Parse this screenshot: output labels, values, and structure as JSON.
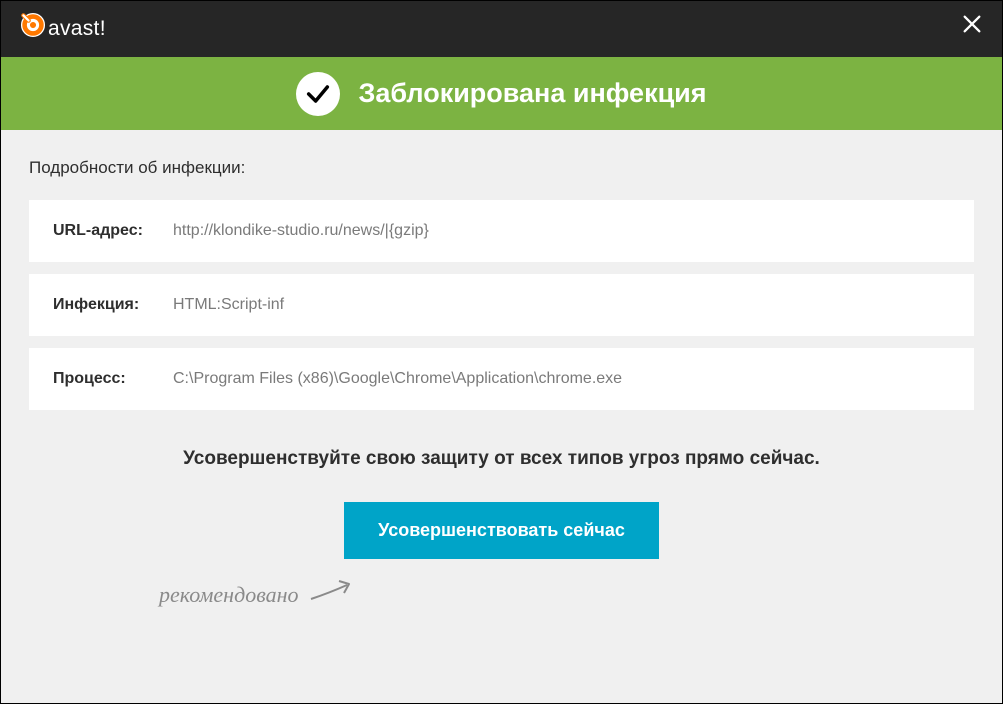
{
  "titlebar": {
    "logo_text": "avast!"
  },
  "banner": {
    "title": "Заблокирована инфекция"
  },
  "details": {
    "section_title": "Подробности об инфекции:",
    "url": {
      "label": "URL-адрес:",
      "value": "http://klondike-studio.ru/news/|{gzip}"
    },
    "infection": {
      "label": "Инфекция:",
      "value": "HTML:Script-inf"
    },
    "process": {
      "label": "Процесс:",
      "value": "C:\\Program Files (x86)\\Google\\Chrome\\Application\\chrome.exe"
    }
  },
  "upgrade": {
    "message": "Усовершенствуйте свою защиту от всех типов угроз прямо сейчас.",
    "button_label": "Усовершенствовать сейчас",
    "recommendation": "рекомендовано"
  }
}
